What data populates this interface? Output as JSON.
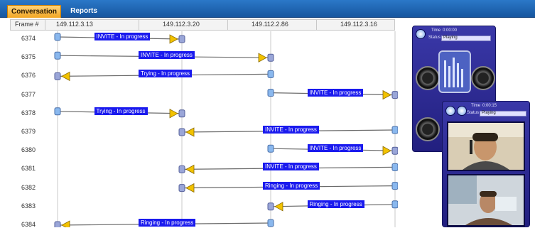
{
  "tabs": [
    {
      "label": "Conversation"
    },
    {
      "label": "Reports"
    }
  ],
  "columns": {
    "frame_label": "Frame #",
    "ips": [
      "149.112.3.13",
      "149.112.3.20",
      "149.112.2.86",
      "149.112.3.16"
    ]
  },
  "rows": [
    {
      "frame": "6374",
      "label": "INVITE - In progress"
    },
    {
      "frame": "6375",
      "label": "INVITE - In progress"
    },
    {
      "frame": "6376",
      "label": "Trying - In progress"
    },
    {
      "frame": "6377",
      "label": "INVITE - In progress"
    },
    {
      "frame": "6378",
      "label": "Trying - In progress"
    },
    {
      "frame": "6379",
      "label": "INVITE - In progress"
    },
    {
      "frame": "6380",
      "label": "INVITE - In progress"
    },
    {
      "frame": "6381",
      "label": "INVITE - In progress"
    },
    {
      "frame": "6382",
      "label": "Ringing - In progress"
    },
    {
      "frame": "6383",
      "label": "Ringing - In progress"
    },
    {
      "frame": "6384",
      "label": "Ringing - In progress"
    }
  ],
  "player_back": {
    "time_label": "Time",
    "time_value": "0:00:00",
    "status_label": "Status",
    "status_value": "Playing"
  },
  "player_front": {
    "time_label": "Time",
    "time_value": "0:00:15",
    "status_label": "Status",
    "status_value": "Playing"
  }
}
